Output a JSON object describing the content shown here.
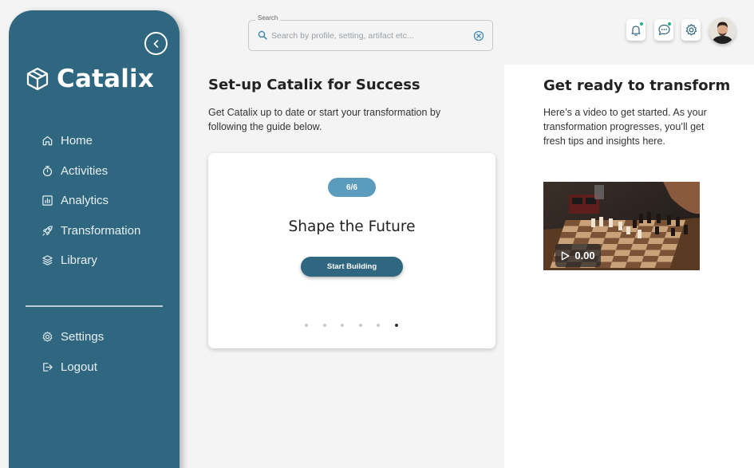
{
  "sidebar": {
    "brand": "Catalix",
    "items": [
      {
        "label": "Home",
        "icon": "home-icon"
      },
      {
        "label": "Activities",
        "icon": "stopwatch-icon"
      },
      {
        "label": "Analytics",
        "icon": "chart-icon"
      },
      {
        "label": "Transformation",
        "icon": "rocket-icon"
      },
      {
        "label": "Library",
        "icon": "layers-icon"
      }
    ],
    "bottom_items": [
      {
        "label": "Settings",
        "icon": "gear-icon"
      },
      {
        "label": "Logout",
        "icon": "logout-icon"
      }
    ]
  },
  "search": {
    "label": "Search",
    "placeholder": "Search by profile, setting, artifact etc...",
    "value": ""
  },
  "main": {
    "title": "Set-up Catalix for Success",
    "description": "Get Catalix up to date or start your transformation by following the guide below.",
    "card": {
      "step": "6/6",
      "title": "Shape the Future",
      "button": "Start Building",
      "total_steps": 6,
      "active_step": 6
    }
  },
  "right_panel": {
    "title": "Get ready to transform",
    "description": "Here’s a video to get started. As your transformation progresses, you’ll get fresh tips and insights here.",
    "video": {
      "time": "0.00"
    }
  },
  "colors": {
    "sidebar": "#2f6680",
    "badge": "#5b9bbb",
    "notification_dot": "#25b37d"
  }
}
